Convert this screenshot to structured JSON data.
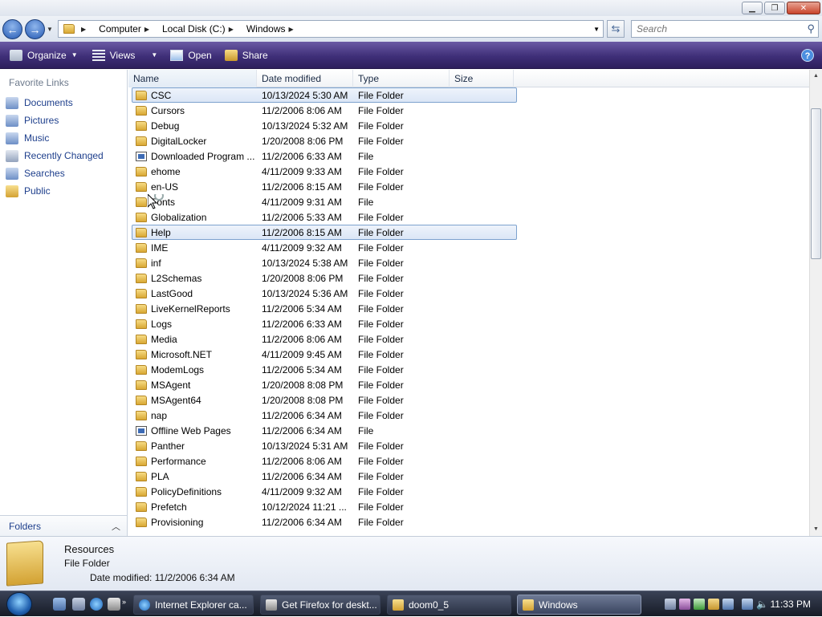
{
  "address": {
    "crumbs": [
      "Computer",
      "Local Disk (C:)",
      "Windows"
    ]
  },
  "search": {
    "placeholder": "Search"
  },
  "toolbar": {
    "organize": "Organize",
    "views": "Views",
    "open": "Open",
    "share": "Share"
  },
  "nav": {
    "title": "Favorite Links",
    "items": [
      "Documents",
      "Pictures",
      "Music",
      "Recently Changed",
      "Searches",
      "Public"
    ],
    "folders": "Folders"
  },
  "columns": {
    "name": "Name",
    "date": "Date modified",
    "type": "Type",
    "size": "Size"
  },
  "files": [
    {
      "name": "CSC",
      "date": "10/13/2024 5:30 AM",
      "type": "File Folder",
      "icon": "folder"
    },
    {
      "name": "Cursors",
      "date": "11/2/2006 8:06 AM",
      "type": "File Folder",
      "icon": "folder"
    },
    {
      "name": "Debug",
      "date": "10/13/2024 5:32 AM",
      "type": "File Folder",
      "icon": "folder"
    },
    {
      "name": "DigitalLocker",
      "date": "1/20/2008 8:06 PM",
      "type": "File Folder",
      "icon": "folder"
    },
    {
      "name": "Downloaded Program ...",
      "date": "11/2/2006 6:33 AM",
      "type": "File",
      "icon": "file"
    },
    {
      "name": "ehome",
      "date": "4/11/2009 9:33 AM",
      "type": "File Folder",
      "icon": "folder"
    },
    {
      "name": "en-US",
      "date": "11/2/2006 8:15 AM",
      "type": "File Folder",
      "icon": "folder"
    },
    {
      "name": "Fonts",
      "date": "4/11/2009 9:31 AM",
      "type": "File",
      "icon": "folder"
    },
    {
      "name": "Globalization",
      "date": "11/2/2006 5:33 AM",
      "type": "File Folder",
      "icon": "folder"
    },
    {
      "name": "Help",
      "date": "11/2/2006 8:15 AM",
      "type": "File Folder",
      "icon": "folder"
    },
    {
      "name": "IME",
      "date": "4/11/2009 9:32 AM",
      "type": "File Folder",
      "icon": "folder"
    },
    {
      "name": "inf",
      "date": "10/13/2024 5:38 AM",
      "type": "File Folder",
      "icon": "folder"
    },
    {
      "name": "L2Schemas",
      "date": "1/20/2008 8:06 PM",
      "type": "File Folder",
      "icon": "folder"
    },
    {
      "name": "LastGood",
      "date": "10/13/2024 5:36 AM",
      "type": "File Folder",
      "icon": "folder"
    },
    {
      "name": "LiveKernelReports",
      "date": "11/2/2006 5:34 AM",
      "type": "File Folder",
      "icon": "folder"
    },
    {
      "name": "Logs",
      "date": "11/2/2006 6:33 AM",
      "type": "File Folder",
      "icon": "folder"
    },
    {
      "name": "Media",
      "date": "11/2/2006 8:06 AM",
      "type": "File Folder",
      "icon": "folder"
    },
    {
      "name": "Microsoft.NET",
      "date": "4/11/2009 9:45 AM",
      "type": "File Folder",
      "icon": "folder"
    },
    {
      "name": "ModemLogs",
      "date": "11/2/2006 5:34 AM",
      "type": "File Folder",
      "icon": "folder"
    },
    {
      "name": "MSAgent",
      "date": "1/20/2008 8:08 PM",
      "type": "File Folder",
      "icon": "folder"
    },
    {
      "name": "MSAgent64",
      "date": "1/20/2008 8:08 PM",
      "type": "File Folder",
      "icon": "folder"
    },
    {
      "name": "nap",
      "date": "11/2/2006 6:34 AM",
      "type": "File Folder",
      "icon": "folder"
    },
    {
      "name": "Offline Web Pages",
      "date": "11/2/2006 6:34 AM",
      "type": "File",
      "icon": "file"
    },
    {
      "name": "Panther",
      "date": "10/13/2024 5:31 AM",
      "type": "File Folder",
      "icon": "folder"
    },
    {
      "name": "Performance",
      "date": "11/2/2006 8:06 AM",
      "type": "File Folder",
      "icon": "folder"
    },
    {
      "name": "PLA",
      "date": "11/2/2006 6:34 AM",
      "type": "File Folder",
      "icon": "folder"
    },
    {
      "name": "PolicyDefinitions",
      "date": "4/11/2009 9:32 AM",
      "type": "File Folder",
      "icon": "folder"
    },
    {
      "name": "Prefetch",
      "date": "10/12/2024 11:21 ...",
      "type": "File Folder",
      "icon": "folder"
    },
    {
      "name": "Provisioning",
      "date": "11/2/2006 6:34 AM",
      "type": "File Folder",
      "icon": "folder"
    }
  ],
  "selected_rows": [
    "CSC",
    "Help"
  ],
  "details": {
    "name": "Resources",
    "type": "File Folder",
    "modified": "Date modified: 11/2/2006 6:34 AM"
  },
  "taskbar": {
    "tasks": [
      "Internet Explorer ca...",
      "Get Firefox for deskt...",
      "doom0_5",
      "Windows"
    ],
    "active_task": "Windows",
    "clock": "11:33 PM"
  }
}
